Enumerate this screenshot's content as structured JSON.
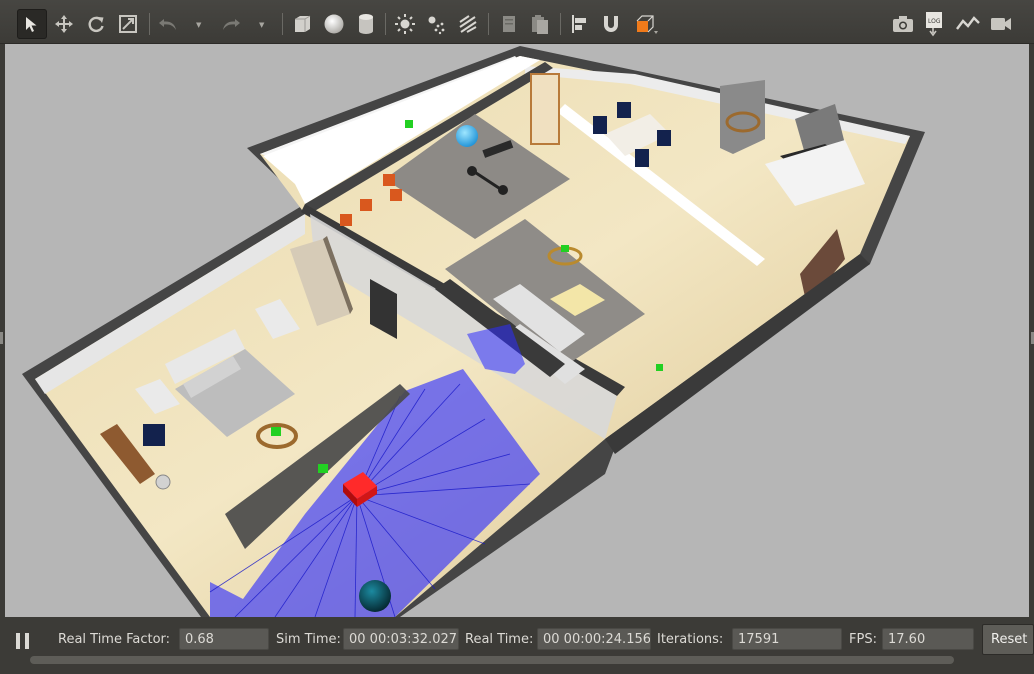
{
  "toolbar": {
    "tools": [
      {
        "name": "select-mode-icon",
        "active": true
      },
      {
        "name": "translate-mode-icon"
      },
      {
        "name": "rotate-mode-icon"
      },
      {
        "name": "scale-mode-icon"
      },
      {
        "name": "undo-icon"
      },
      {
        "name": "redo-icon"
      },
      {
        "name": "box-shape-icon"
      },
      {
        "name": "sphere-shape-icon"
      },
      {
        "name": "cylinder-shape-icon"
      },
      {
        "name": "point-light-icon"
      },
      {
        "name": "spot-light-icon"
      },
      {
        "name": "directional-light-icon"
      },
      {
        "name": "copy-icon"
      },
      {
        "name": "paste-icon"
      },
      {
        "name": "align-icon"
      },
      {
        "name": "magnet-snap-icon"
      },
      {
        "name": "change-view-icon"
      },
      {
        "name": "screenshot-icon"
      },
      {
        "name": "log-icon"
      },
      {
        "name": "plot-icon"
      },
      {
        "name": "record-video-icon"
      }
    ],
    "log_label": "LOG",
    "accent_orange": "#f07a1a"
  },
  "viewport": {
    "background": "#b6b6b6",
    "floor_color": "#e3cf9c",
    "laser_color": "#2b2bff",
    "robot_color": "#e01414"
  },
  "status": {
    "real_time_factor_label": "Real Time Factor:",
    "real_time_factor": "0.68",
    "sim_time_label": "Sim Time:",
    "sim_time": "00 00:03:32.027",
    "real_time_label": "Real Time:",
    "real_time": "00 00:00:24.156",
    "iterations_label": "Iterations:",
    "iterations": "17591",
    "fps_label": "FPS:",
    "fps": "17.60",
    "reset_label": "Reset"
  }
}
